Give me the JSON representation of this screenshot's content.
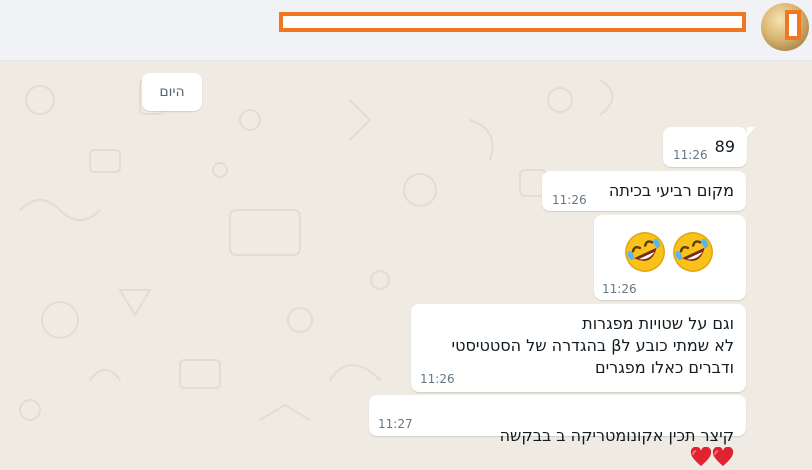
{
  "chat": {
    "header": {
      "title": "",
      "subtitle": "",
      "avatar": "group-avatar"
    },
    "date_divider": "היום",
    "messages": [
      {
        "text": "89",
        "time": "11:26"
      },
      {
        "text": "מקום רביעי בכיתה",
        "time": "11:26"
      },
      {
        "emoji": [
          "rolling-on-floor-laughing",
          "rolling-on-floor-laughing"
        ],
        "time": "11:26"
      },
      {
        "text": "וגם על שטויות מפגרות\nלא שמתי כובע לβ בהגדרה של הסטטיסטי\nודברים כאלו מפגרים",
        "time": "11:26"
      },
      {
        "text": "קיצר תכין אקונומטריקה ב בבקשה",
        "emoji": [
          "red-heart",
          "red-heart"
        ],
        "time": "11:27"
      }
    ]
  },
  "colors": {
    "chat_background": "#efeae2",
    "header_background": "#f0f2f5",
    "bubble": "#ffffff",
    "timestamp": "#667781",
    "redaction_border": "#f0771f",
    "heart": "#e0242f"
  }
}
